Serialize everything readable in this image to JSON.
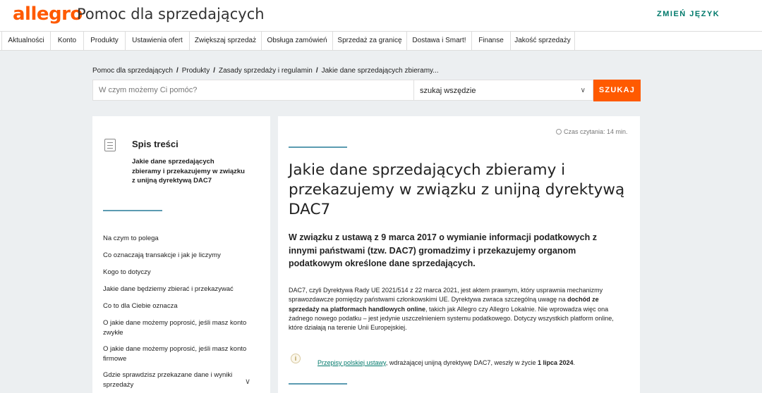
{
  "header": {
    "logo": "allegro",
    "title": "Pomoc dla sprzedających",
    "lang_button": "ZMIEŃ JĘZYK"
  },
  "nav": [
    "Aktualności",
    "Konto",
    "Produkty",
    "Ustawienia ofert",
    "Zwiększaj sprzedaż",
    "Obsługa zamówień",
    "Sprzedaż za granicę",
    "Dostawa i Smart!",
    "Finanse",
    "Jakość sprzedaży"
  ],
  "breadcrumb": [
    "Pomoc dla sprzedających",
    "Produkty",
    "Zasady sprzedaży i regulamin",
    "Jakie dane sprzedających zbieramy..."
  ],
  "search": {
    "placeholder": "W czym możemy Ci pomóc?",
    "scope": "szukaj wszędzie",
    "button": "SZUKAJ"
  },
  "toc": {
    "title": "Spis treści",
    "current": "Jakie dane sprzedających zbieramy i przekazujemy w związku z unijną dyrektywą DAC7",
    "items": [
      "Na czym to polega",
      "Co oznaczają transakcje i jak je liczymy",
      "Kogo to dotyczy",
      "Jakie dane będziemy zbierać i przekazywać",
      "Co to dla Ciebie oznacza",
      "O jakie dane możemy poprosić, jeśli masz konto zwykłe",
      "O jakie dane możemy poprosić, jeśli masz konto firmowe",
      "Gdzie sprawdzisz przekazane dane i wyniki sprzedaży"
    ]
  },
  "article": {
    "read_time": "Czas czytania: 14 min.",
    "title": "Jakie dane sprzedających zbieramy i przekazujemy w związku z unijną dyrektywą DAC7",
    "lead": "W związku z ustawą z 9 marca 2017 o wymianie informacji podatkowych z innymi państwami (tzw. DAC7) gromadzimy i przekazujemy organom podatkowym określone dane sprzedających.",
    "body_1": "DAC7, czyli Dyrektywa Rady UE 2021/514 z 22 marca 2021, jest aktem prawnym, który usprawnia mechanizmy sprawozdawcze pomiędzy państwami członkowskimi UE. Dyrektywa zwraca szczególną uwagę na ",
    "body_bold": "dochód ze sprzedaży na platformach handlowych online",
    "body_2": ", takich jak Allegro czy Allegro Lokalnie. Nie wprowadza więc ona żadnego nowego podatku – jest jedynie uszczelnieniem systemu podatkowego. Dotyczy wszystkich platform online, które działają na terenie Unii Europejskiej.",
    "note_link": "Przepisy polskiej ustawy",
    "note_text": ", wdrażającej unijną dyrektywę DAC7, weszły w życie ",
    "note_bold": "1 lipca 2024",
    "note_end": "."
  }
}
